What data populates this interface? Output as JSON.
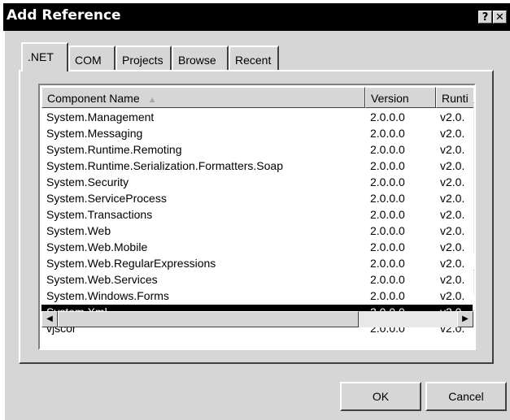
{
  "window": {
    "title": "Add Reference",
    "help_glyph": "?",
    "close_glyph": "✕"
  },
  "tabs": [
    {
      "label": ".NET",
      "active": true
    },
    {
      "label": "COM",
      "active": false
    },
    {
      "label": "Projects",
      "active": false
    },
    {
      "label": "Browse",
      "active": false
    },
    {
      "label": "Recent",
      "active": false
    }
  ],
  "list": {
    "columns": [
      "Component Name",
      "Version",
      "Runti"
    ],
    "sort_indicator": "▲",
    "rows": [
      {
        "name": "System.Management",
        "version": "2.0.0.0",
        "runtime": "v2.0."
      },
      {
        "name": "System.Messaging",
        "version": "2.0.0.0",
        "runtime": "v2.0."
      },
      {
        "name": "System.Runtime.Remoting",
        "version": "2.0.0.0",
        "runtime": "v2.0."
      },
      {
        "name": "System.Runtime.Serialization.Formatters.Soap",
        "version": "2.0.0.0",
        "runtime": "v2.0."
      },
      {
        "name": "System.Security",
        "version": "2.0.0.0",
        "runtime": "v2.0."
      },
      {
        "name": "System.ServiceProcess",
        "version": "2.0.0.0",
        "runtime": "v2.0."
      },
      {
        "name": "System.Transactions",
        "version": "2.0.0.0",
        "runtime": "v2.0."
      },
      {
        "name": "System.Web",
        "version": "2.0.0.0",
        "runtime": "v2.0."
      },
      {
        "name": "System.Web.Mobile",
        "version": "2.0.0.0",
        "runtime": "v2.0."
      },
      {
        "name": "System.Web.RegularExpressions",
        "version": "2.0.0.0",
        "runtime": "v2.0."
      },
      {
        "name": "System.Web.Services",
        "version": "2.0.0.0",
        "runtime": "v2.0."
      },
      {
        "name": "System.Windows.Forms",
        "version": "2.0.0.0",
        "runtime": "v2.0."
      },
      {
        "name": "System.Xml",
        "version": "2.0.0.0",
        "runtime": "v2.0.",
        "selected": true
      },
      {
        "name": "vjscor",
        "version": "2.0.0.0",
        "runtime": "v2.0."
      }
    ]
  },
  "scrollbar": {
    "up_glyph": "▲",
    "down_glyph": "▼",
    "left_glyph": "◀",
    "right_glyph": "▶"
  },
  "buttons": {
    "ok": "OK",
    "cancel": "Cancel"
  },
  "colors": {
    "face": "#d6d6d6",
    "selection": "#000000",
    "titlebar": "#000000"
  }
}
